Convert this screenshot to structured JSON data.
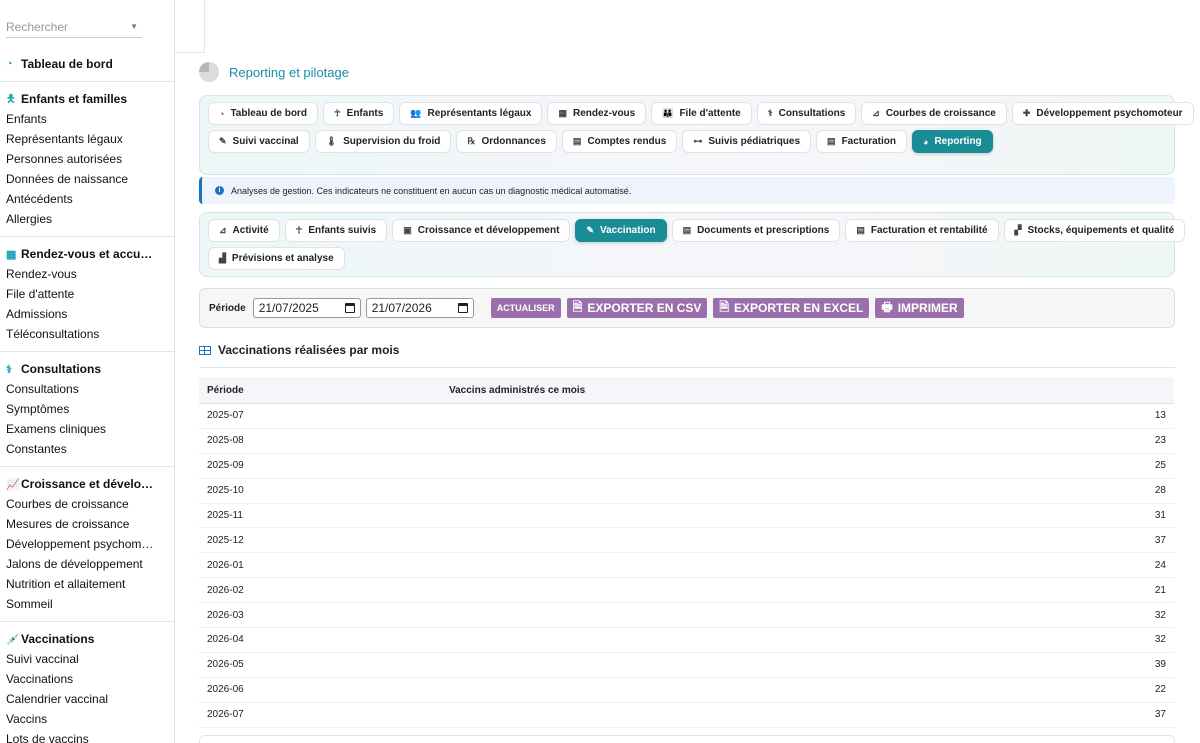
{
  "sidebar": {
    "search_placeholder": "Rechercher",
    "groups": [
      {
        "icon": "gauge-icon",
        "glyph": "◔",
        "title": "Tableau de bord",
        "items": []
      },
      {
        "icon": "child-icon",
        "glyph": "🯅",
        "title": "Enfants et familles",
        "items": [
          "Enfants",
          "Représentants légaux",
          "Personnes autorisées",
          "Données de naissance",
          "Antécédents",
          "Allergies"
        ]
      },
      {
        "icon": "calendar-icon",
        "glyph": "▦",
        "title": "Rendez-vous et accu…",
        "items": [
          "Rendez-vous",
          "File d'attente",
          "Admissions",
          "Téléconsultations"
        ]
      },
      {
        "icon": "stethoscope-icon",
        "glyph": "⚕",
        "title": "Consultations",
        "items": [
          "Consultations",
          "Symptômes",
          "Examens cliniques",
          "Constantes"
        ]
      },
      {
        "icon": "chart-line-icon",
        "glyph": "📈",
        "title": "Croissance et dévelo…",
        "items": [
          "Courbes de croissance",
          "Mesures de croissance",
          "Développement psychom…",
          "Jalons de développement",
          "Nutrition et allaitement",
          "Sommeil"
        ]
      },
      {
        "icon": "syringe-icon",
        "glyph": "💉",
        "title": "Vaccinations",
        "items": [
          "Suivi vaccinal",
          "Vaccinations",
          "Calendrier vaccinal",
          "Vaccins",
          "Lots de vaccins"
        ]
      }
    ]
  },
  "page": {
    "title": "Reporting et pilotage"
  },
  "module_tabs": {
    "row1": [
      {
        "label": "Tableau de bord",
        "icon": "gauge-icon"
      },
      {
        "label": "Enfants",
        "icon": "child-icon"
      },
      {
        "label": "Représentants légaux",
        "icon": "users-icon"
      },
      {
        "label": "Rendez-vous",
        "icon": "calendar-icon"
      },
      {
        "label": "File d'attente",
        "icon": "people-queue-icon"
      },
      {
        "label": "Consultations",
        "icon": "stethoscope-icon"
      },
      {
        "label": "Courbes de croissance",
        "icon": "chart-line-icon"
      },
      {
        "label": "Développement psychomoteur",
        "icon": "puzzle-icon"
      }
    ],
    "row2": [
      {
        "label": "Suivi vaccinal",
        "icon": "syringe-icon"
      },
      {
        "label": "Supervision du froid",
        "icon": "thermometer-icon"
      },
      {
        "label": "Ordonnances",
        "icon": "prescription-icon"
      },
      {
        "label": "Comptes rendus",
        "icon": "file-icon"
      },
      {
        "label": "Suivis pédiatriques",
        "icon": "sitemap-icon"
      },
      {
        "label": "Facturation",
        "icon": "invoice-icon"
      },
      {
        "label": "Reporting",
        "icon": "pie-chart-icon",
        "active": true
      }
    ]
  },
  "info": {
    "text": "Analyses de gestion. Ces indicateurs ne constituent en aucun cas un diagnostic médical automatisé."
  },
  "report_tabs": {
    "row1": [
      {
        "label": "Activité",
        "icon": "chart-line-icon"
      },
      {
        "label": "Enfants suivis",
        "icon": "child-icon"
      },
      {
        "label": "Croissance et développement",
        "icon": "briefcase-medical-icon"
      },
      {
        "label": "Vaccination",
        "icon": "syringe-icon",
        "active": true
      },
      {
        "label": "Documents et prescriptions",
        "icon": "file-icon"
      },
      {
        "label": "Facturation et rentabilité",
        "icon": "invoice-icon"
      },
      {
        "label": "Stocks, équipements et qualité",
        "icon": "boxes-icon"
      }
    ],
    "row2": [
      {
        "label": "Prévisions et analyse",
        "icon": "chart-area-icon"
      }
    ]
  },
  "filters": {
    "label": "Période",
    "date_from": "21/07/2025",
    "date_to": "21/07/2026",
    "refresh_label": "ACTUALISER",
    "csv_label": "EXPORTER EN CSV",
    "excel_label": "EXPORTER EN EXCEL",
    "print_label": "IMPRIMER"
  },
  "section": {
    "title": "Vaccinations réalisées par mois"
  },
  "table": {
    "columns": [
      "Période",
      "Vaccins administrés ce mois"
    ],
    "rows": [
      [
        "2025-07",
        "13"
      ],
      [
        "2025-08",
        "23"
      ],
      [
        "2025-09",
        "25"
      ],
      [
        "2025-10",
        "28"
      ],
      [
        "2025-11",
        "31"
      ],
      [
        "2025-12",
        "37"
      ],
      [
        "2026-01",
        "24"
      ],
      [
        "2026-02",
        "21"
      ],
      [
        "2026-03",
        "32"
      ],
      [
        "2026-04",
        "32"
      ],
      [
        "2026-05",
        "39"
      ],
      [
        "2026-06",
        "22"
      ],
      [
        "2026-07",
        "37"
      ]
    ]
  }
}
